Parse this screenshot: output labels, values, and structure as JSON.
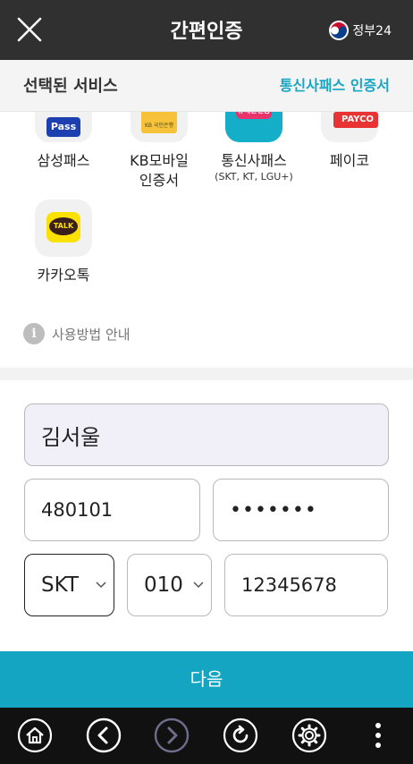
{
  "header": {
    "title": "간편인증",
    "gov_label": "정부24"
  },
  "service_bar": {
    "label": "선택된 서비스",
    "selected": "통신사패스 인증서"
  },
  "providers": [
    {
      "name": "삼성패스",
      "sub": "",
      "logo_text": "Pass"
    },
    {
      "name": "KB모바일\n인증서",
      "sub": "",
      "logo_text": "KB 국민은행"
    },
    {
      "name": "통신사패스",
      "sub": "(SKT, KT, LGU+)",
      "logo_text": "PASS\n휴대폰인증"
    },
    {
      "name": "페이코",
      "sub": "",
      "logo_text": "PAYCO"
    },
    {
      "name": "카카오톡",
      "sub": "",
      "logo_text": "TALK"
    }
  ],
  "guide": {
    "label": "사용방법 안내"
  },
  "form": {
    "name": "김서울",
    "birth": "480101",
    "password_masked": "•••••••",
    "carrier": "SKT",
    "prefix": "010",
    "number": "12345678"
  },
  "next_label": "다음",
  "colors": {
    "header_bg": "#303030",
    "accent": "#14a5c3",
    "nav_bg": "#111111",
    "name_field_bg": "#f1f0f8"
  },
  "nav_icons": [
    "home-icon",
    "back-icon",
    "forward-icon",
    "refresh-icon",
    "settings-icon",
    "more-icon"
  ]
}
